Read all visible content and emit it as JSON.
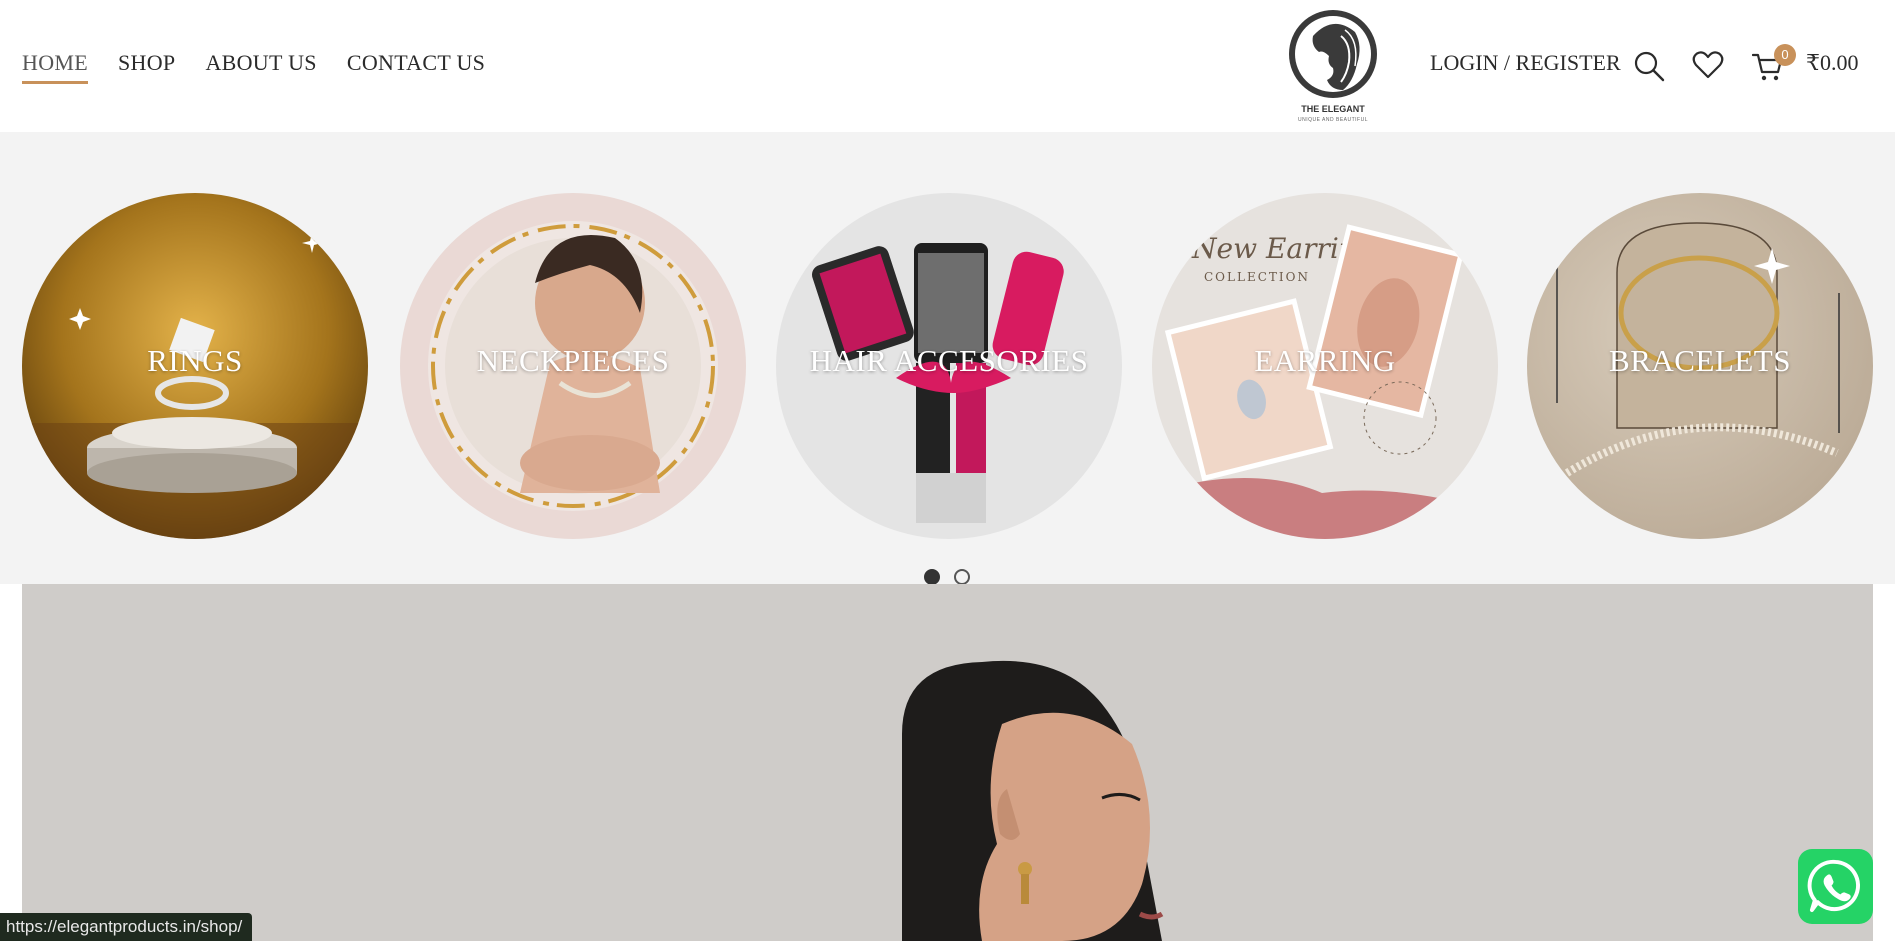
{
  "nav": {
    "items": [
      {
        "label": "HOME",
        "active": true
      },
      {
        "label": "SHOP",
        "active": false
      },
      {
        "label": "ABOUT US",
        "active": false
      },
      {
        "label": "CONTACT US",
        "active": false
      }
    ]
  },
  "logo": {
    "name": "THE ELEGANT",
    "tagline": "UNIQUE AND BEAUTIFUL"
  },
  "header": {
    "login_label": "LOGIN / REGISTER",
    "cart_count": "0",
    "cart_total": "₹0.00",
    "icons": [
      "search-icon",
      "heart-icon",
      "cart-icon"
    ]
  },
  "categories": [
    {
      "label": "RINGS"
    },
    {
      "label": "NECKPIECES"
    },
    {
      "label": "HAIR ACCESORIES"
    },
    {
      "label": "EARRING",
      "image_text": "New Earring",
      "image_subtext": "COLLECTION"
    },
    {
      "label": "BRACELETS"
    }
  ],
  "carousel": {
    "total_pages": 2,
    "active_page": 1
  },
  "status_url": "https://elegantproducts.in/shop/",
  "colors": {
    "accent": "#c8915a",
    "band_bg": "#f3f3f3",
    "whatsapp": "#25d366"
  }
}
